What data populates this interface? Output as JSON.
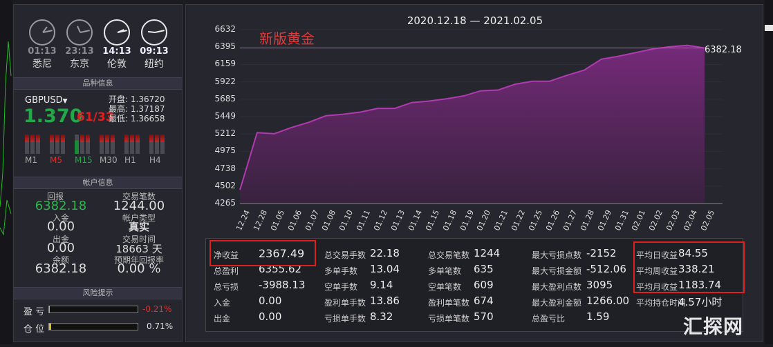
{
  "clocks": [
    {
      "time": "01:13",
      "city": "悉尼",
      "active": false,
      "h": 1,
      "m": 13
    },
    {
      "time": "23:13",
      "city": "东京",
      "active": false,
      "h": 23,
      "m": 13
    },
    {
      "time": "14:13",
      "city": "伦敦",
      "active": true,
      "h": 14,
      "m": 13
    },
    {
      "time": "09:13",
      "city": "纽约",
      "active": true,
      "h": 9,
      "m": 13
    }
  ],
  "symbol_section": {
    "header": "品种信息",
    "symbol": "GBPUSD",
    "price_main": "1.370",
    "price_small": "61/33",
    "open_label": "开盘:",
    "open": "1.36720",
    "high_label": "最高:",
    "high": "1.37187",
    "low_label": "最低:",
    "low": "1.36658",
    "timeframes": [
      "M1",
      "M5",
      "M15",
      "M30",
      "H1",
      "H4"
    ]
  },
  "account_section": {
    "header": "帐户信息",
    "return_label": "回报",
    "return": "6382.18",
    "trades_label": "交易笔数",
    "trades": "1244.00",
    "deposit_label": "入金",
    "deposit": "0.00",
    "type_label": "帐户类型",
    "type": "真实",
    "withdraw_label": "出金",
    "withdraw": "0.00",
    "time_label": "交易时间",
    "time": "18663 天",
    "balance_label": "余额",
    "balance": "6382.18",
    "annual_label": "预期年回报率",
    "annual": "0.00 %"
  },
  "risk_section": {
    "header": "风险提示",
    "pnl_label": "盈 亏",
    "pnl": "-0.21%",
    "pos_label": "仓 位",
    "pos": "0.71%",
    "pnl_fill": 0.01,
    "pos_fill": 0.02
  },
  "chart_data": {
    "type": "area",
    "title": "2020.12.18 — 2021.02.05",
    "annotation": "新版黄金",
    "last_value_label": "6382.18",
    "ylim": [
      4265,
      6632
    ],
    "yticks": [
      6632,
      6395,
      6159,
      5922,
      5685,
      5449,
      5212,
      4975,
      4738,
      4502,
      4265
    ],
    "categories": [
      "12.24",
      "12.28",
      "01.05",
      "01.06",
      "01.07",
      "01.08",
      "01.10",
      "01.11",
      "01.12",
      "01.13",
      "01.14",
      "01.15",
      "01.18",
      "01.19",
      "01.20",
      "01.21",
      "01.22",
      "01.25",
      "01.26",
      "01.27",
      "01.28",
      "01.29",
      "01.31",
      "02.01",
      "02.02",
      "02.03",
      "02.04",
      "02.05"
    ],
    "values": [
      4450,
      5230,
      5215,
      5300,
      5370,
      5460,
      5480,
      5510,
      5560,
      5560,
      5640,
      5660,
      5690,
      5730,
      5800,
      5810,
      5890,
      5930,
      5930,
      6010,
      6080,
      6230,
      6270,
      6320,
      6370,
      6400,
      6420,
      6382
    ],
    "color": "#b03ab0"
  },
  "stats": [
    {
      "label": "净收益",
      "value": "2367.49"
    },
    {
      "label": "总盈利",
      "value": "6355.62"
    },
    {
      "label": "总亏损",
      "value": "-3988.13"
    },
    {
      "label": "入金",
      "value": "0.00"
    },
    {
      "label": "出金",
      "value": "0.00"
    },
    {
      "label": "总交易手数",
      "value": "22.18"
    },
    {
      "label": "多单手数",
      "value": "13.04"
    },
    {
      "label": "空单手数",
      "value": "9.14"
    },
    {
      "label": "盈利单手数",
      "value": "13.86"
    },
    {
      "label": "亏损单手数",
      "value": "8.32"
    },
    {
      "label": "总交易笔数",
      "value": "1244"
    },
    {
      "label": "多单笔数",
      "value": "635"
    },
    {
      "label": "空单笔数",
      "value": "609"
    },
    {
      "label": "盈利单笔数",
      "value": "674"
    },
    {
      "label": "亏损单笔数",
      "value": "570"
    },
    {
      "label": "最大亏损点数",
      "value": "-2152"
    },
    {
      "label": "最大亏损金额",
      "value": "-512.06"
    },
    {
      "label": "最大盈利点数",
      "value": "3095"
    },
    {
      "label": "最大盈利金额",
      "value": "1266.00"
    },
    {
      "label": "总盈亏比",
      "value": "1.59"
    },
    {
      "label": "平均日收益",
      "value": "84.55"
    },
    {
      "label": "平均周收益",
      "value": "338.21"
    },
    {
      "label": "平均月收益",
      "value": "1183.74"
    },
    {
      "label": "平均持仓时间",
      "value": "4.57小时"
    }
  ],
  "watermark": "汇探网"
}
